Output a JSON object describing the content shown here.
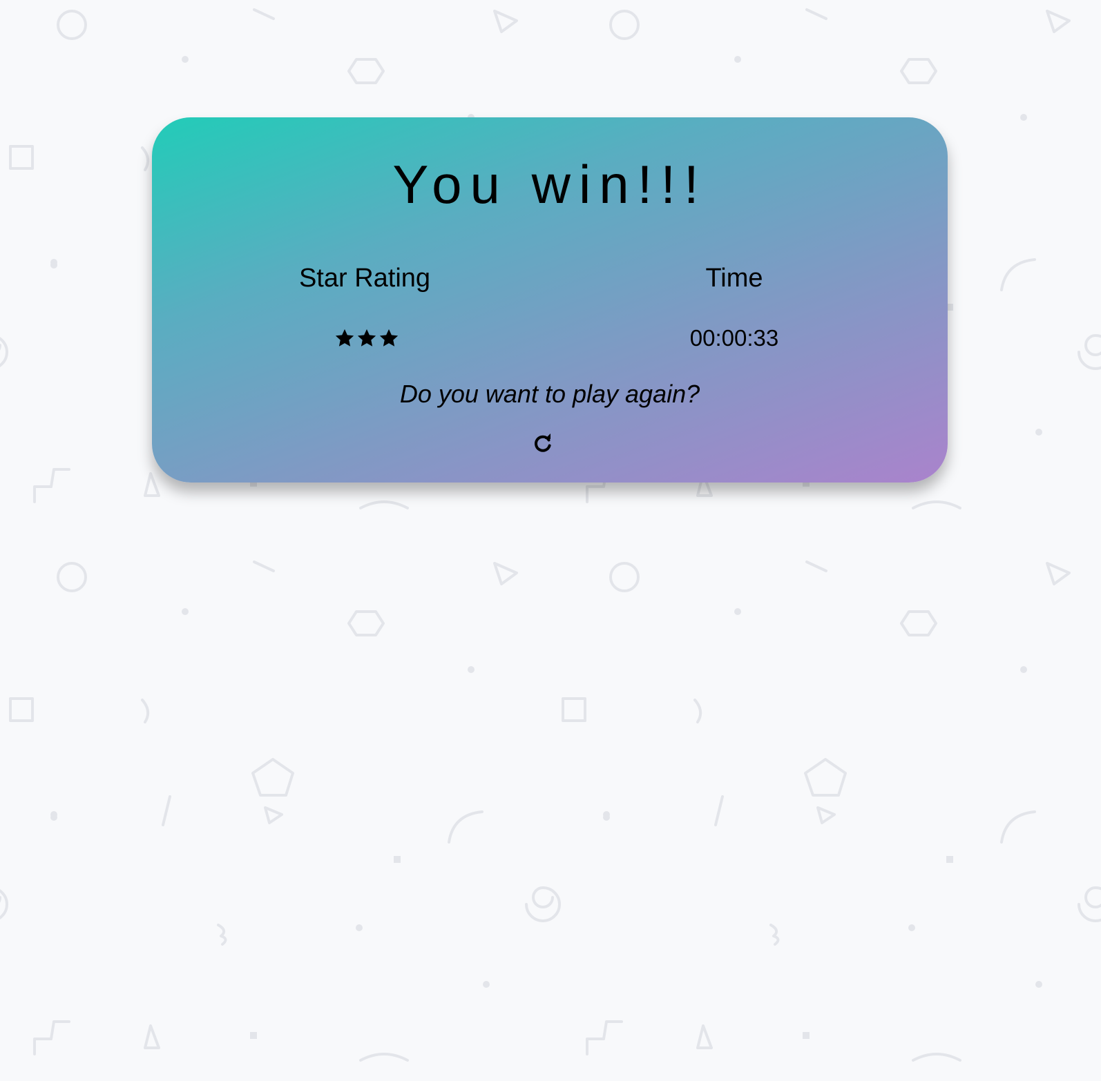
{
  "modal": {
    "title": "You win!!!",
    "star_rating_label": "Star Rating",
    "time_label": "Time",
    "stars": 3,
    "time_value": "00:00:33",
    "play_again_prompt": "Do you want to play again?",
    "restart_icon": "redo-icon"
  },
  "colors": {
    "gradient_start": "#22ccb8",
    "gradient_end": "#aa83cc",
    "background": "#f8f9fb",
    "pattern": "#e3e5ea"
  }
}
